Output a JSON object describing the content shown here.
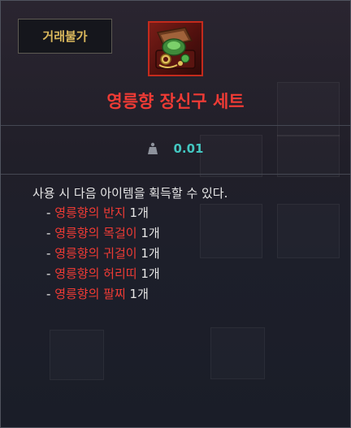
{
  "tooltip": {
    "tag_label": "거래불가",
    "item_icon": "accessory-set-chest-icon",
    "title": "영릉향 장신구 세트",
    "weight_icon": "weight-icon",
    "weight_value": "0.01",
    "description": "사용 시 다음 아이템을 획득할 수 있다.",
    "items": [
      {
        "bullet": "- ",
        "name": "영릉향의 반지",
        "qty": " 1개"
      },
      {
        "bullet": "- ",
        "name": "영릉향의 목걸이",
        "qty": " 1개"
      },
      {
        "bullet": "- ",
        "name": "영릉향의 귀걸이",
        "qty": " 1개"
      },
      {
        "bullet": "- ",
        "name": "영릉향의 허리띠",
        "qty": " 1개"
      },
      {
        "bullet": "- ",
        "name": "영릉향의 팔찌",
        "qty": " 1개"
      }
    ]
  },
  "colors": {
    "title_red": "#ef3b35",
    "tag_gold": "#d9b75c",
    "weight_teal": "#43c6c0",
    "icon_border": "#c42a1c"
  }
}
